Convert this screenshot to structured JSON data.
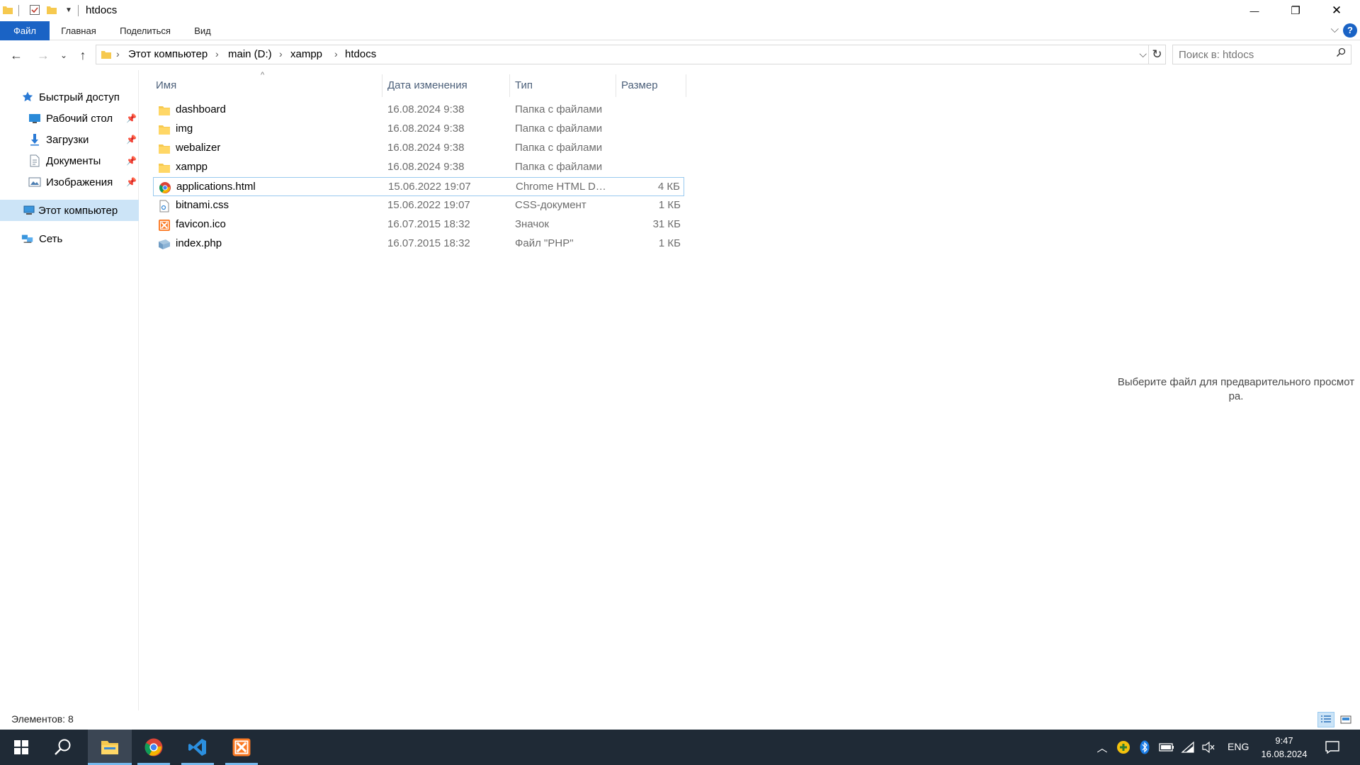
{
  "window": {
    "title": "htdocs",
    "minimize_glyph": "—",
    "maximize_glyph": "❐",
    "close_glyph": "✕"
  },
  "ribbon": {
    "tabs": [
      "Файл",
      "Главная",
      "Поделиться",
      "Вид"
    ],
    "help_glyph": "?"
  },
  "address": {
    "path": [
      "Этот компьютер",
      "main (D:)",
      "xampp",
      "htdocs"
    ]
  },
  "search": {
    "placeholder": "Поиск в: htdocs"
  },
  "sidebar": {
    "quick_access": "Быстрый доступ",
    "items": [
      {
        "label": "Рабочий стол",
        "icon": "desktop-icon",
        "pinned": true
      },
      {
        "label": "Загрузки",
        "icon": "downloads-icon",
        "pinned": true
      },
      {
        "label": "Документы",
        "icon": "documents-icon",
        "pinned": true
      },
      {
        "label": "Изображения",
        "icon": "pictures-icon",
        "pinned": true
      }
    ],
    "this_pc": "Этот компьютер",
    "network": "Сеть"
  },
  "columns": {
    "name": "Имя",
    "date": "Дата изменения",
    "type": "Тип",
    "size": "Размер"
  },
  "files": [
    {
      "name": "dashboard",
      "date": "16.08.2024 9:38",
      "type": "Папка с файлами",
      "size": "",
      "icon": "folder-icon"
    },
    {
      "name": "img",
      "date": "16.08.2024 9:38",
      "type": "Папка с файлами",
      "size": "",
      "icon": "folder-icon"
    },
    {
      "name": "webalizer",
      "date": "16.08.2024 9:38",
      "type": "Папка с файлами",
      "size": "",
      "icon": "folder-icon"
    },
    {
      "name": "xampp",
      "date": "16.08.2024 9:38",
      "type": "Папка с файлами",
      "size": "",
      "icon": "folder-icon"
    },
    {
      "name": "applications.html",
      "date": "15.06.2022 19:07",
      "type": "Chrome HTML Do...",
      "size": "4 КБ",
      "icon": "chrome-icon"
    },
    {
      "name": "bitnami.css",
      "date": "15.06.2022 19:07",
      "type": "CSS-документ",
      "size": "1 КБ",
      "icon": "css-file-icon"
    },
    {
      "name": "favicon.ico",
      "date": "16.07.2015 18:32",
      "type": "Значок",
      "size": "31 КБ",
      "icon": "xampp-icon"
    },
    {
      "name": "index.php",
      "date": "16.07.2015 18:32",
      "type": "Файл \"PHP\"",
      "size": "1 КБ",
      "icon": "php-file-icon"
    }
  ],
  "preview": {
    "line1": "Выберите файл для предварительного просмот",
    "line2": "ра."
  },
  "status": {
    "count": "Элементов: 8"
  },
  "taskbar": {
    "language": "ENG",
    "time": "9:47",
    "date": "16.08.2024"
  },
  "colors": {
    "accent": "#1a63c5",
    "selection": "#cce4f7",
    "folder": "#f6c94f",
    "taskbar": "#1f2a36"
  }
}
